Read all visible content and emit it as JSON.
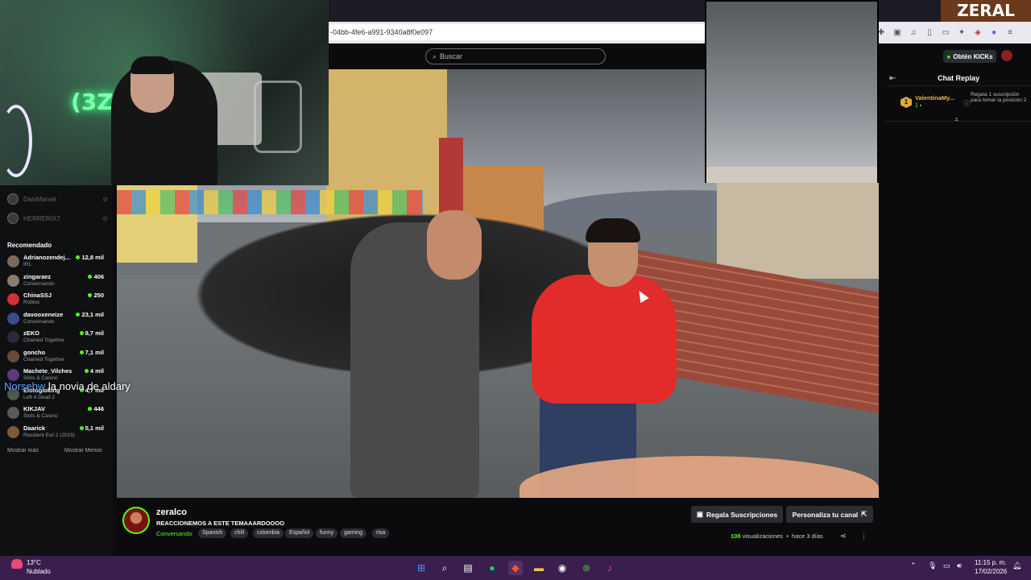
{
  "browser": {
    "url": "-04bb-4fe6-a991-9340a8f0e097",
    "brand_overlay": "ZERAL"
  },
  "header": {
    "search_placeholder": "Buscar",
    "get_kicks": "Obtén KICKs"
  },
  "sidebar": {
    "following": [
      {
        "name": "DaniMarvel"
      },
      {
        "name": "HERRERIX7"
      }
    ],
    "recommended_title": "Recomendado",
    "recommended": [
      {
        "name": "Adrianozendej...",
        "category": "IRL",
        "viewers": "12,8 mil",
        "color": "#7a6a5a"
      },
      {
        "name": "zingaraez",
        "category": "Conversando",
        "viewers": "406",
        "color": "#8a7a70"
      },
      {
        "name": "ChinaSSJ",
        "category": "Roblox",
        "viewers": "250",
        "color": "#d0303a"
      },
      {
        "name": "davooxeneize",
        "category": "Conversando",
        "viewers": "23,1 mil",
        "color": "#3a4a8a"
      },
      {
        "name": "zEKO",
        "category": "Chained Together",
        "viewers": "8,7 mil",
        "color": "#2a2a3a"
      },
      {
        "name": "goncho",
        "category": "Chained Together",
        "viewers": "7,1 mil",
        "color": "#6a4a3a"
      },
      {
        "name": "Machete_Vilches",
        "category": "Slots & Casino",
        "viewers": "4 mil",
        "color": "#5a3a7a"
      },
      {
        "name": "Elotogioking",
        "category": "Left 4 Dead 2",
        "viewers": "4,7 mil",
        "color": "#4a5a4a"
      },
      {
        "name": "KIKJAV",
        "category": "Slots & Casino",
        "viewers": "446",
        "color": "#5a5a5a"
      },
      {
        "name": "Daarick",
        "category": "Resident Evil 2 (2019)",
        "viewers": "5,1 mil",
        "color": "#7a5a3a"
      }
    ],
    "show_more": "Mostrar más",
    "show_less": "Mostrar Menos"
  },
  "caption": {
    "speaker": "Norsebw",
    "text": " la novia de aldary"
  },
  "chat": {
    "title": "Chat Replay",
    "gift_user": "ValentinaMy...",
    "gift_count": "1",
    "gift_rank": "1",
    "gift_text": "Regala 1 suscripción para tomar la posición 2"
  },
  "stream": {
    "streamer": "zeralco",
    "title": "REACCIONEMOS A ESTE TEMAAARDOOOO",
    "category": "Conversando",
    "tags": [
      "Spanish",
      "chill",
      "colombia",
      "Español",
      "funny",
      "gaming",
      "risa"
    ],
    "gift_button": "Regala Suscripciones",
    "customize_button": "Personaliza tu canal",
    "views_count": "108",
    "views_label": "visualizaciones",
    "time_ago": "hace 3 días"
  },
  "taskbar": {
    "temp": "13°C",
    "weather": "Nublado",
    "time": "11:15 p. m.",
    "date": "17/02/2026"
  }
}
